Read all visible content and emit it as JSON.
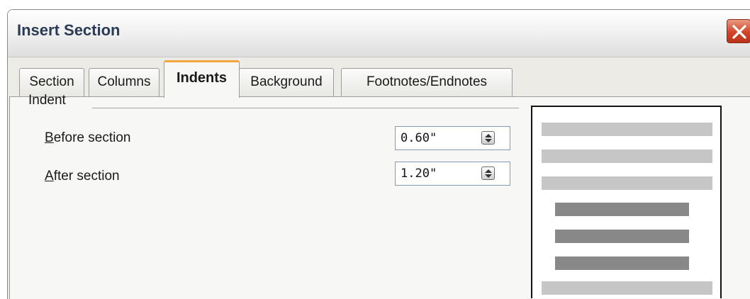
{
  "window": {
    "title": "Insert Section"
  },
  "tabs": [
    {
      "label": "Section",
      "active": false
    },
    {
      "label": "Columns",
      "active": false
    },
    {
      "label": "Indents",
      "active": true
    },
    {
      "label": "Background",
      "active": false
    },
    {
      "label": "Footnotes/Endnotes",
      "active": false
    }
  ],
  "indent_group": {
    "label": "Indent",
    "before": {
      "accesskey": "B",
      "label_rest": "efore section",
      "value": "0.60\""
    },
    "after": {
      "accesskey": "A",
      "label_rest": "fter section",
      "value": "1.20\""
    }
  },
  "colors": {
    "accent_tab": "#f3a43a",
    "close_button": "#d2462a",
    "preview_dark": "#888888",
    "preview_light": "#c6c6c6"
  },
  "icons": {
    "close": "close-icon",
    "spin": "spin-arrows-icon"
  }
}
